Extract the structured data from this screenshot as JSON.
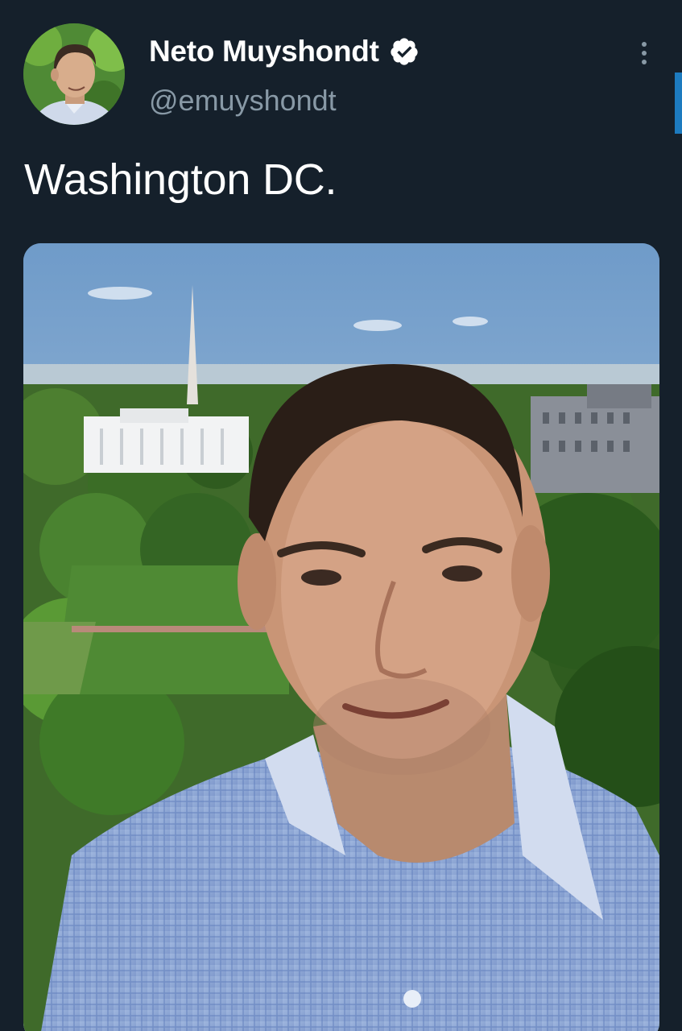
{
  "tweet": {
    "author": {
      "display_name": "Neto Muyshondt",
      "handle": "@emuyshondt",
      "verified": true,
      "avatar_icon": "profile-photo"
    },
    "text": "Washington DC.",
    "media": {
      "type": "photo",
      "icon": "selfie-photo"
    }
  },
  "icons": {
    "verified": "verified-badge-icon",
    "more": "more-vertical-icon"
  },
  "colors": {
    "background": "#15202b",
    "primary_text": "#ffffff",
    "secondary_text": "#8899a6",
    "accent": "#1d7bbf"
  }
}
